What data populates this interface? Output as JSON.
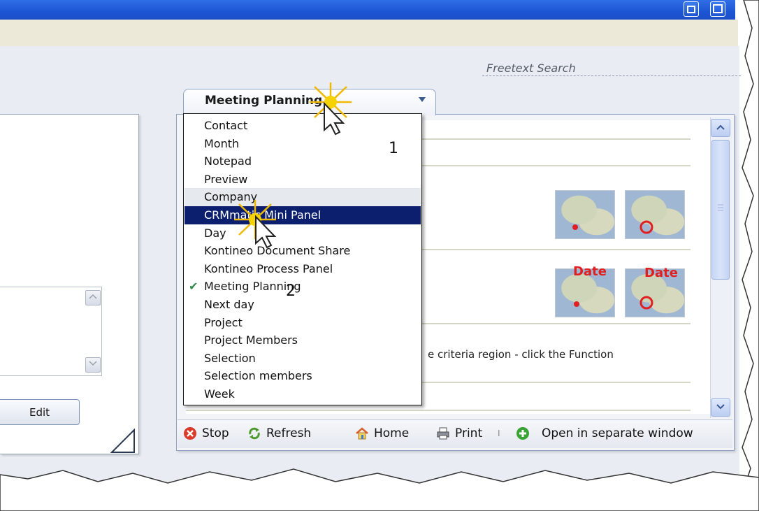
{
  "search": {
    "placeholder": "Freetext Search"
  },
  "left_panel": {
    "edit_label": "Edit"
  },
  "tab": {
    "label": "Meeting Planning"
  },
  "dropdown": {
    "items": [
      "Contact",
      "Month",
      "Notepad",
      "Preview",
      "Company",
      "CRMmatic Mini Panel",
      "Day",
      "Kontineo Document Share",
      "Kontineo Process Panel",
      "Meeting Planning",
      "Next day",
      "Project",
      "Project Members",
      "Selection",
      "Selection members",
      "Week"
    ],
    "hovered": "Company",
    "selected": "CRMmatic Mini Panel",
    "checked": "Meeting Planning"
  },
  "annotations": {
    "step1": "1",
    "step2": "2"
  },
  "content": {
    "map_label_1": "Date",
    "map_label_2": "Date",
    "body_text": "e criteria region - click the Function"
  },
  "toolbar": {
    "stop": "Stop",
    "refresh": "Refresh",
    "home": "Home",
    "print": "Print",
    "separator": "I",
    "open_separate": "Open in separate window"
  },
  "colors": {
    "selected_bg": "#0b1f6e",
    "check": "#2f8a4a",
    "title_bar": "#1d55d4",
    "date_label": "#e02020"
  }
}
